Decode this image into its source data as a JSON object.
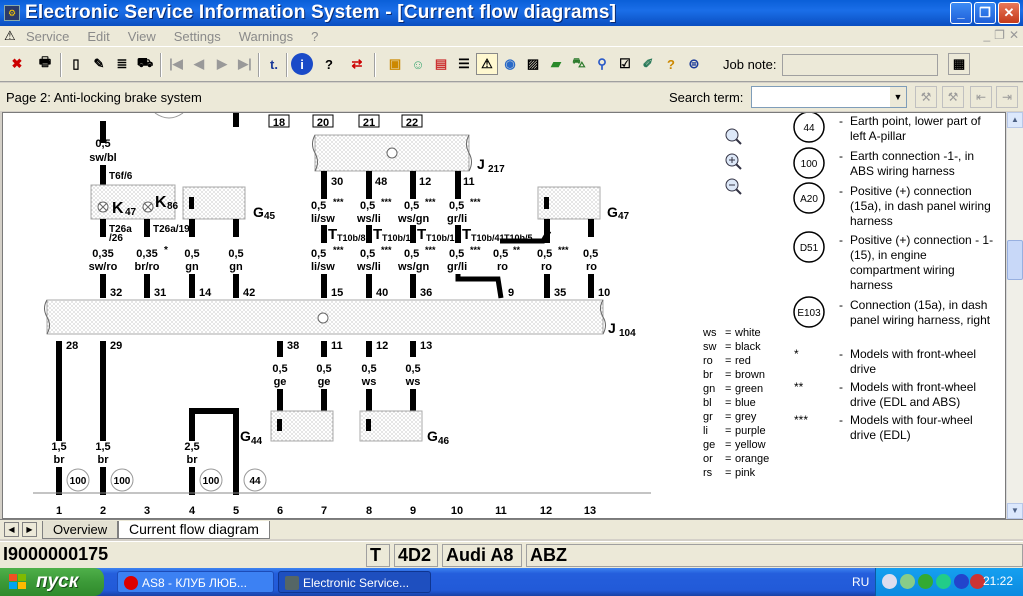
{
  "window": {
    "title": "Electronic Service Information System - [Current flow diagrams]"
  },
  "menu": {
    "items": [
      "Service",
      "Edit",
      "View",
      "Settings",
      "Warnings",
      "?"
    ]
  },
  "toolbar": {
    "job_note_label": "Job note:",
    "job_note_value": ""
  },
  "pagebar": {
    "page_label": "Page 2: Anti-locking brake system",
    "search_label": "Search term:",
    "search_value": ""
  },
  "diagram": {
    "top_numbers": [
      "18",
      "20",
      "21",
      "22"
    ],
    "left_connector_label": "T6f/6",
    "left_wire": {
      "size": "0,5",
      "color": "sw/bl"
    },
    "components": {
      "k47": "K",
      "k47_sub": "47",
      "k86": "K",
      "k86_sub": "86",
      "g45": "G",
      "g45_sub": "45",
      "g47": "G",
      "g47_sub": "47",
      "j217": "J",
      "j217_sub": "217",
      "j104": "J",
      "j104_sub": "104",
      "g44": "G",
      "g44_sub": "44",
      "g46": "G",
      "g46_sub": "46"
    },
    "j217_pins": [
      {
        "pin": "30",
        "size": "0,5",
        "stars": "***",
        "color": "li/sw"
      },
      {
        "pin": "48",
        "size": "0,5",
        "stars": "***",
        "color": "ws/li"
      },
      {
        "pin": "12",
        "size": "0,5",
        "stars": "***",
        "color": "ws/gn"
      },
      {
        "pin": "11",
        "size": "0,5",
        "stars": "***",
        "color": "gr/li"
      }
    ],
    "t10_connectors": [
      "T10b/8",
      "T10b/10",
      "T10b/1",
      "T10b/41",
      "T10b/5"
    ],
    "t26a_labels": [
      "T26a",
      "/26",
      "T26a/19"
    ],
    "upper_wires": [
      {
        "size": "0,35",
        "stars": "",
        "color": "sw/ro",
        "pin": "32"
      },
      {
        "size": "0,35",
        "stars": "*",
        "color": "br/ro",
        "pin": "31"
      },
      {
        "size": "0,5",
        "stars": "",
        "color": "gn",
        "pin": "14"
      },
      {
        "size": "0,5",
        "stars": "",
        "color": "gn",
        "pin": "42"
      },
      {
        "size": "0,5",
        "stars": "***",
        "color": "li/sw",
        "pin": "15"
      },
      {
        "size": "0,5",
        "stars": "***",
        "color": "ws/li",
        "pin": "40"
      },
      {
        "size": "0,5",
        "stars": "***",
        "color": "ws/gn",
        "pin": "36"
      },
      {
        "size": "0,5",
        "stars": "***",
        "color": "gr/li",
        "pin": ""
      },
      {
        "size": "0,5",
        "stars": "**",
        "color": "ro",
        "pin": "9"
      },
      {
        "size": "0,5",
        "stars": "***",
        "color": "ro",
        "pin": "35"
      },
      {
        "size": "0,5",
        "stars": "",
        "color": "ro",
        "pin": "10"
      }
    ],
    "lower_wires": [
      {
        "pin": "28",
        "size": "1,5",
        "color": "br",
        "ground": "100"
      },
      {
        "pin": "29",
        "size": "1,5",
        "color": "br",
        "ground": "100"
      },
      {
        "pin": "",
        "size": "2,5",
        "color": "br",
        "ground": "100"
      },
      {
        "pin": "",
        "size": "",
        "color": "",
        "ground": "44"
      }
    ],
    "g44_wires": [
      {
        "pin": "38",
        "size": "0,5",
        "color": "ge"
      },
      {
        "pin": "11",
        "size": "0,5",
        "color": "ge"
      }
    ],
    "g46_wires": [
      {
        "pin": "12",
        "size": "0,5",
        "color": "ws"
      },
      {
        "pin": "13",
        "size": "0,5",
        "color": "ws"
      }
    ],
    "bottom_numbers": [
      "1",
      "2",
      "3",
      "4",
      "5",
      "6",
      "7",
      "8",
      "9",
      "10",
      "11",
      "12",
      "13"
    ],
    "color_key": [
      {
        "code": "ws",
        "name": "white"
      },
      {
        "code": "sw",
        "name": "black"
      },
      {
        "code": "ro",
        "name": "red"
      },
      {
        "code": "br",
        "name": "brown"
      },
      {
        "code": "gn",
        "name": "green"
      },
      {
        "code": "bl",
        "name": "blue"
      },
      {
        "code": "gr",
        "name": "grey"
      },
      {
        "code": "li",
        "name": "purple"
      },
      {
        "code": "ge",
        "name": "yellow"
      },
      {
        "code": "or",
        "name": "orange"
      },
      {
        "code": "rs",
        "name": "pink"
      }
    ],
    "legend": [
      {
        "mark": "44",
        "text": "Earth point, lower part of left A-pillar"
      },
      {
        "mark": "100",
        "text": "Earth connection -1-, in ABS wiring harness"
      },
      {
        "mark": "A20",
        "text": "Positive (+) connection (15a), in dash panel wiring harness"
      },
      {
        "mark": "D51",
        "text": "Positive (+) connection - 1- (15), in engine compartment wiring harness"
      },
      {
        "mark": "E103",
        "text": "Connection (15a), in dash panel wiring harness, right"
      },
      {
        "mark": "*",
        "text": "Models with front-wheel drive"
      },
      {
        "mark": "**",
        "text": "Models with front-wheel drive (EDL and ABS)"
      },
      {
        "mark": "***",
        "text": "Models with four-wheel drive (EDL)"
      }
    ]
  },
  "tabs": [
    {
      "label": "Overview"
    },
    {
      "label": "Current flow diagram"
    }
  ],
  "status": {
    "doc_id": "I9000000175",
    "f1": "T",
    "f2": "4D2",
    "f3": "Audi A8",
    "f4": "ABZ"
  },
  "taskbar": {
    "start_label": "пуск",
    "tasks": [
      {
        "label": "AS8 - КЛУБ ЛЮБ...",
        "icon": "opera-icon"
      },
      {
        "label": "Electronic Service...",
        "icon": "app-icon"
      }
    ],
    "lang": "RU",
    "clock": "21:22"
  }
}
